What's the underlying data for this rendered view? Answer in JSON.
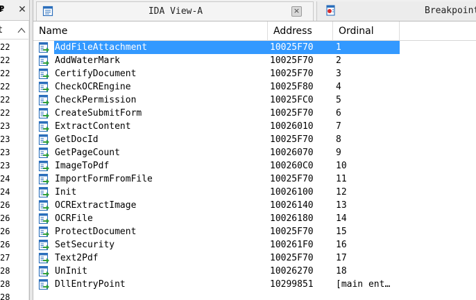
{
  "left_pane": {
    "tab_text": "₽",
    "header_text": "t",
    "rows": [
      "22",
      "22",
      "22",
      "22",
      "22",
      "22",
      "23",
      "23",
      "23",
      "23",
      "24",
      "24",
      "26",
      "26",
      "26",
      "26",
      "27",
      "28",
      "28",
      "28"
    ]
  },
  "tabs": {
    "ida_view": {
      "label": "IDA View-A",
      "close": "×"
    },
    "breakpoints": {
      "label": "Breakpoint"
    }
  },
  "columns": {
    "name": "Name",
    "address": "Address",
    "ordinal": "Ordinal"
  },
  "rows": [
    {
      "name": "AddFileAttachment",
      "address": "10025F70",
      "ordinal": "1",
      "selected": true
    },
    {
      "name": "AddWaterMark",
      "address": "10025F70",
      "ordinal": "2"
    },
    {
      "name": "CertifyDocument",
      "address": "10025F70",
      "ordinal": "3"
    },
    {
      "name": "CheckOCREngine",
      "address": "10025F80",
      "ordinal": "4"
    },
    {
      "name": "CheckPermission",
      "address": "10025FC0",
      "ordinal": "5"
    },
    {
      "name": "CreateSubmitForm",
      "address": "10025F70",
      "ordinal": "6"
    },
    {
      "name": "ExtractContent",
      "address": "10026010",
      "ordinal": "7"
    },
    {
      "name": "GetDocId",
      "address": "10025F70",
      "ordinal": "8"
    },
    {
      "name": "GetPageCount",
      "address": "10026070",
      "ordinal": "9"
    },
    {
      "name": "ImageToPdf",
      "address": "100260C0",
      "ordinal": "10"
    },
    {
      "name": "ImportFormFromFile",
      "address": "10025F70",
      "ordinal": "11"
    },
    {
      "name": "Init",
      "address": "10026100",
      "ordinal": "12"
    },
    {
      "name": "OCRExtractImage",
      "address": "10026140",
      "ordinal": "13"
    },
    {
      "name": "OCRFile",
      "address": "10026180",
      "ordinal": "14"
    },
    {
      "name": "ProtectDocument",
      "address": "10025F70",
      "ordinal": "15"
    },
    {
      "name": "SetSecurity",
      "address": "100261F0",
      "ordinal": "16"
    },
    {
      "name": "Text2Pdf",
      "address": "10025F70",
      "ordinal": "17"
    },
    {
      "name": "UnInit",
      "address": "10026270",
      "ordinal": "18"
    },
    {
      "name": "DllEntryPoint",
      "address": "10299851",
      "ordinal": "[main ent…"
    }
  ],
  "colors": {
    "selection": "#3399ff",
    "icon_blue": "#2a6ebb",
    "icon_green": "#2e9e3a"
  },
  "icons": {
    "row": "export-entry-icon",
    "ida_tab": "ida-view-icon",
    "break_tab": "breakpoint-icon"
  }
}
